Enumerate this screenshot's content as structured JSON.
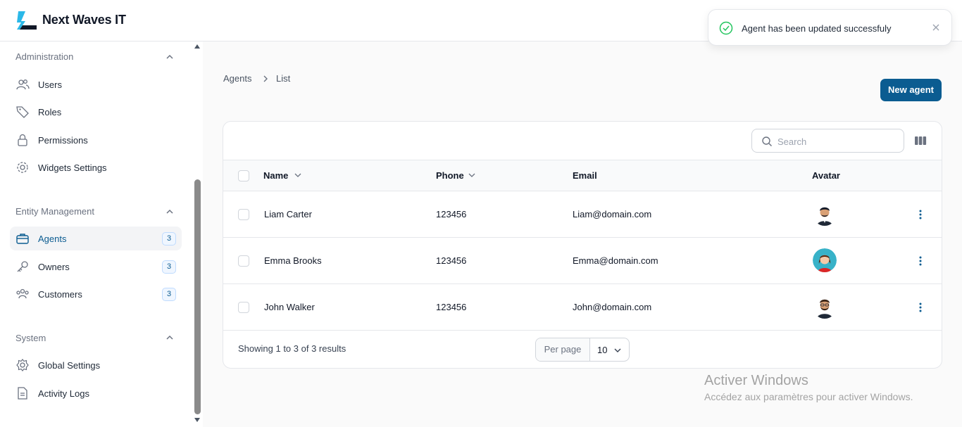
{
  "app": {
    "brand": "Next Waves IT"
  },
  "sidebar": {
    "sections": [
      {
        "title": "Administration",
        "items": [
          {
            "label": "Users",
            "icon": "users-icon"
          },
          {
            "label": "Roles",
            "icon": "tag-icon"
          },
          {
            "label": "Permissions",
            "icon": "lock-icon"
          },
          {
            "label": "Widgets Settings",
            "icon": "gear-icon"
          }
        ]
      },
      {
        "title": "Entity Management",
        "items": [
          {
            "label": "Agents",
            "icon": "briefcase-icon",
            "badge": "3",
            "active": true
          },
          {
            "label": "Owners",
            "icon": "key-icon",
            "badge": "3"
          },
          {
            "label": "Customers",
            "icon": "group-icon",
            "badge": "3"
          }
        ]
      },
      {
        "title": "System",
        "items": [
          {
            "label": "Global Settings",
            "icon": "settings-icon"
          },
          {
            "label": "Activity Logs",
            "icon": "document-icon"
          }
        ]
      }
    ]
  },
  "breadcrumb": {
    "parent": "Agents",
    "current": "List"
  },
  "actions": {
    "new_label": "New agent"
  },
  "search": {
    "placeholder": "Search",
    "value": ""
  },
  "table": {
    "columns": {
      "name": "Name",
      "phone": "Phone",
      "email": "Email",
      "avatar": "Avatar"
    },
    "rows": [
      {
        "name": "Liam Carter",
        "phone": "123456",
        "email": "Liam@domain.com",
        "avatar": "male-avatar-1"
      },
      {
        "name": "Emma Brooks",
        "phone": "123456",
        "email": "Emma@domain.com",
        "avatar": "female-avatar"
      },
      {
        "name": "John Walker",
        "phone": "123456",
        "email": "John@domain.com",
        "avatar": "male-avatar-2"
      }
    ]
  },
  "pagination": {
    "summary": "Showing 1 to 3 of 3 results",
    "per_page_label": "Per page",
    "per_page_value": "10"
  },
  "toast": {
    "message": "Agent has been updated successfuly",
    "status_color": "#22c55e"
  },
  "watermark": {
    "line1": "Activer Windows",
    "line2": "Accédez aux paramètres pour activer Windows."
  },
  "colors": {
    "accent": "#0b5c91"
  }
}
